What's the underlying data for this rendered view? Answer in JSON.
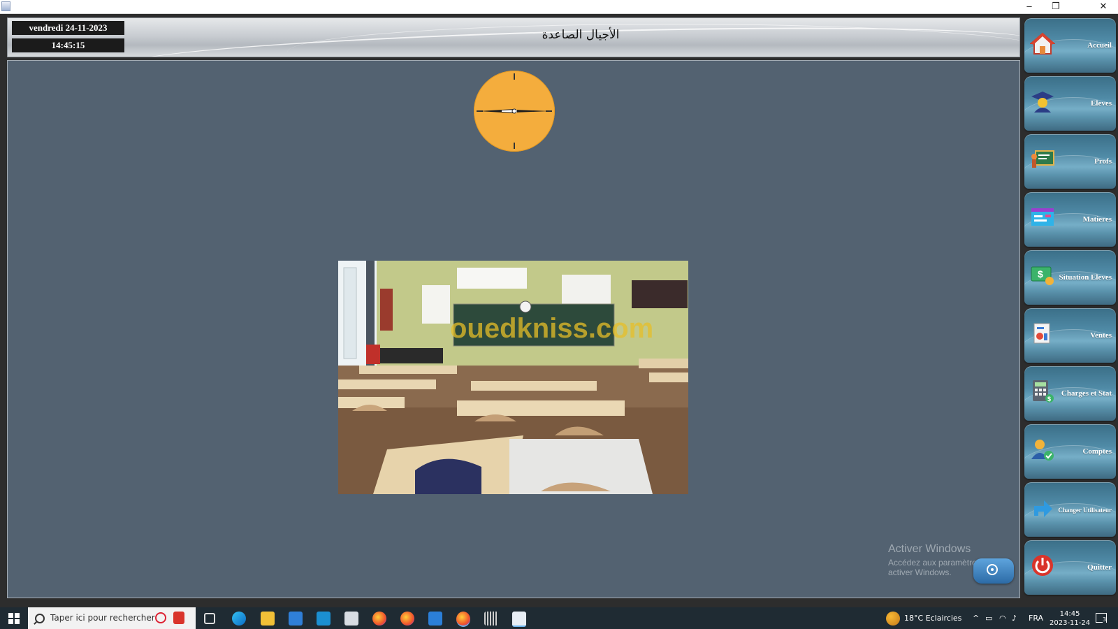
{
  "window": {
    "minimize": "–",
    "restore": "❐",
    "close": "✕"
  },
  "header": {
    "date": "vendredi 24-11-2023",
    "time": "14:45:15",
    "title": "الأجيال الصاعدة"
  },
  "watermark": {
    "line1": "Activer Windows",
    "line2": "Accédez aux paramètres pour activer Windows."
  },
  "photo_watermark": "ouedkniss.com",
  "sidebar": {
    "items": [
      {
        "label": "Accueil",
        "icon": "home-icon"
      },
      {
        "label": "Eleves",
        "icon": "graduate-icon"
      },
      {
        "label": "Profs",
        "icon": "teacher-board-icon"
      },
      {
        "label": "Matieres",
        "icon": "subjects-icon"
      },
      {
        "label": "Situation Eleves",
        "icon": "money-icon"
      },
      {
        "label": "Ventes",
        "icon": "sales-icon"
      },
      {
        "label": "Charges et Stat",
        "icon": "calculator-icon"
      },
      {
        "label": "Comptes",
        "icon": "user-check-icon"
      },
      {
        "label": "Changer Utilisateur",
        "icon": "switch-user-icon"
      },
      {
        "label": "Quitter",
        "icon": "power-icon"
      }
    ]
  },
  "taskbar": {
    "search_placeholder": "Taper ici pour rechercher",
    "weather": "18°C  Eclaircies",
    "language": "FRA",
    "clock_time": "14:45",
    "clock_date": "2023-11-24",
    "notification_count": "3"
  },
  "colors": {
    "main_bg": "#536271",
    "clock_face": "#f4ad3d",
    "sidebar_button": "#4f8aa6"
  }
}
